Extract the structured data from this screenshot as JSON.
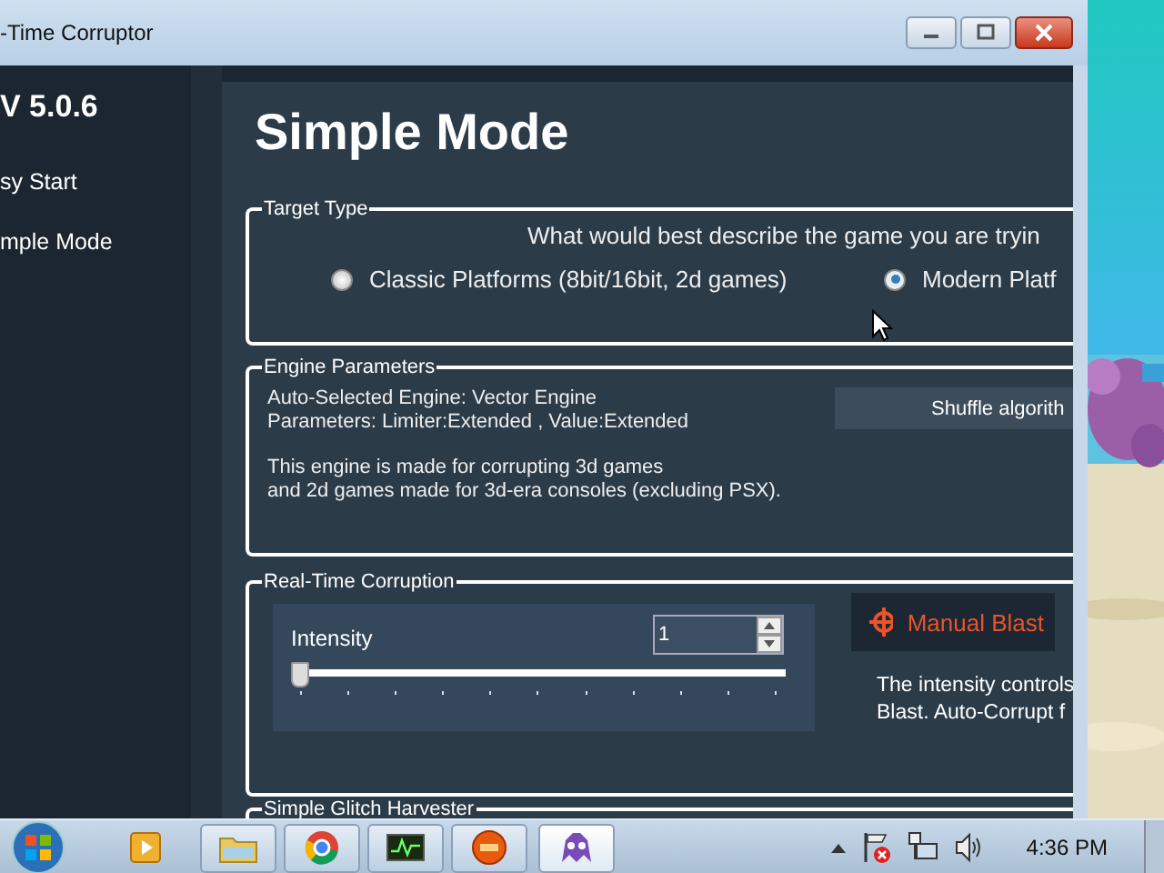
{
  "window": {
    "title": "-Time Corruptor"
  },
  "sidebar": {
    "version": "V 5.0.6",
    "items": [
      "sy Start",
      "mple Mode"
    ]
  },
  "page_title": "Simple Mode",
  "target_type": {
    "legend": "Target Type",
    "question": "What would best describe the game you are tryin",
    "options": [
      {
        "label": "Classic Platforms (8bit/16bit, 2d games)",
        "selected": false
      },
      {
        "label": "Modern Platf",
        "selected": true
      }
    ]
  },
  "engine_parameters": {
    "legend": "Engine Parameters",
    "lines": [
      "Auto-Selected Engine: Vector Engine",
      "Parameters: Limiter:Extended , Value:Extended"
    ],
    "description": [
      "This engine is made for corrupting 3d games",
      "and 2d games made for 3d-era consoles (excluding PSX)."
    ],
    "shuffle_button": "Shuffle algorith"
  },
  "real_time_corruption": {
    "legend": "Real-Time Corruption",
    "intensity": {
      "label": "Intensity",
      "value": "1",
      "level": 0
    },
    "manual_blast": "Manual Blast",
    "description": [
      "The intensity controls",
      "Blast. Auto-Corrupt f"
    ]
  },
  "glitch_harvester": {
    "legend": "Simple Glitch Harvester"
  },
  "taskbar": {
    "apps": [
      {
        "kind": "media",
        "active": false
      },
      {
        "kind": "folder",
        "active": false
      },
      {
        "kind": "browser",
        "active": false
      },
      {
        "kind": "monitor",
        "active": false
      },
      {
        "kind": "stop",
        "active": false
      },
      {
        "kind": "creature",
        "active": true
      }
    ],
    "clock": "4:36 PM"
  }
}
